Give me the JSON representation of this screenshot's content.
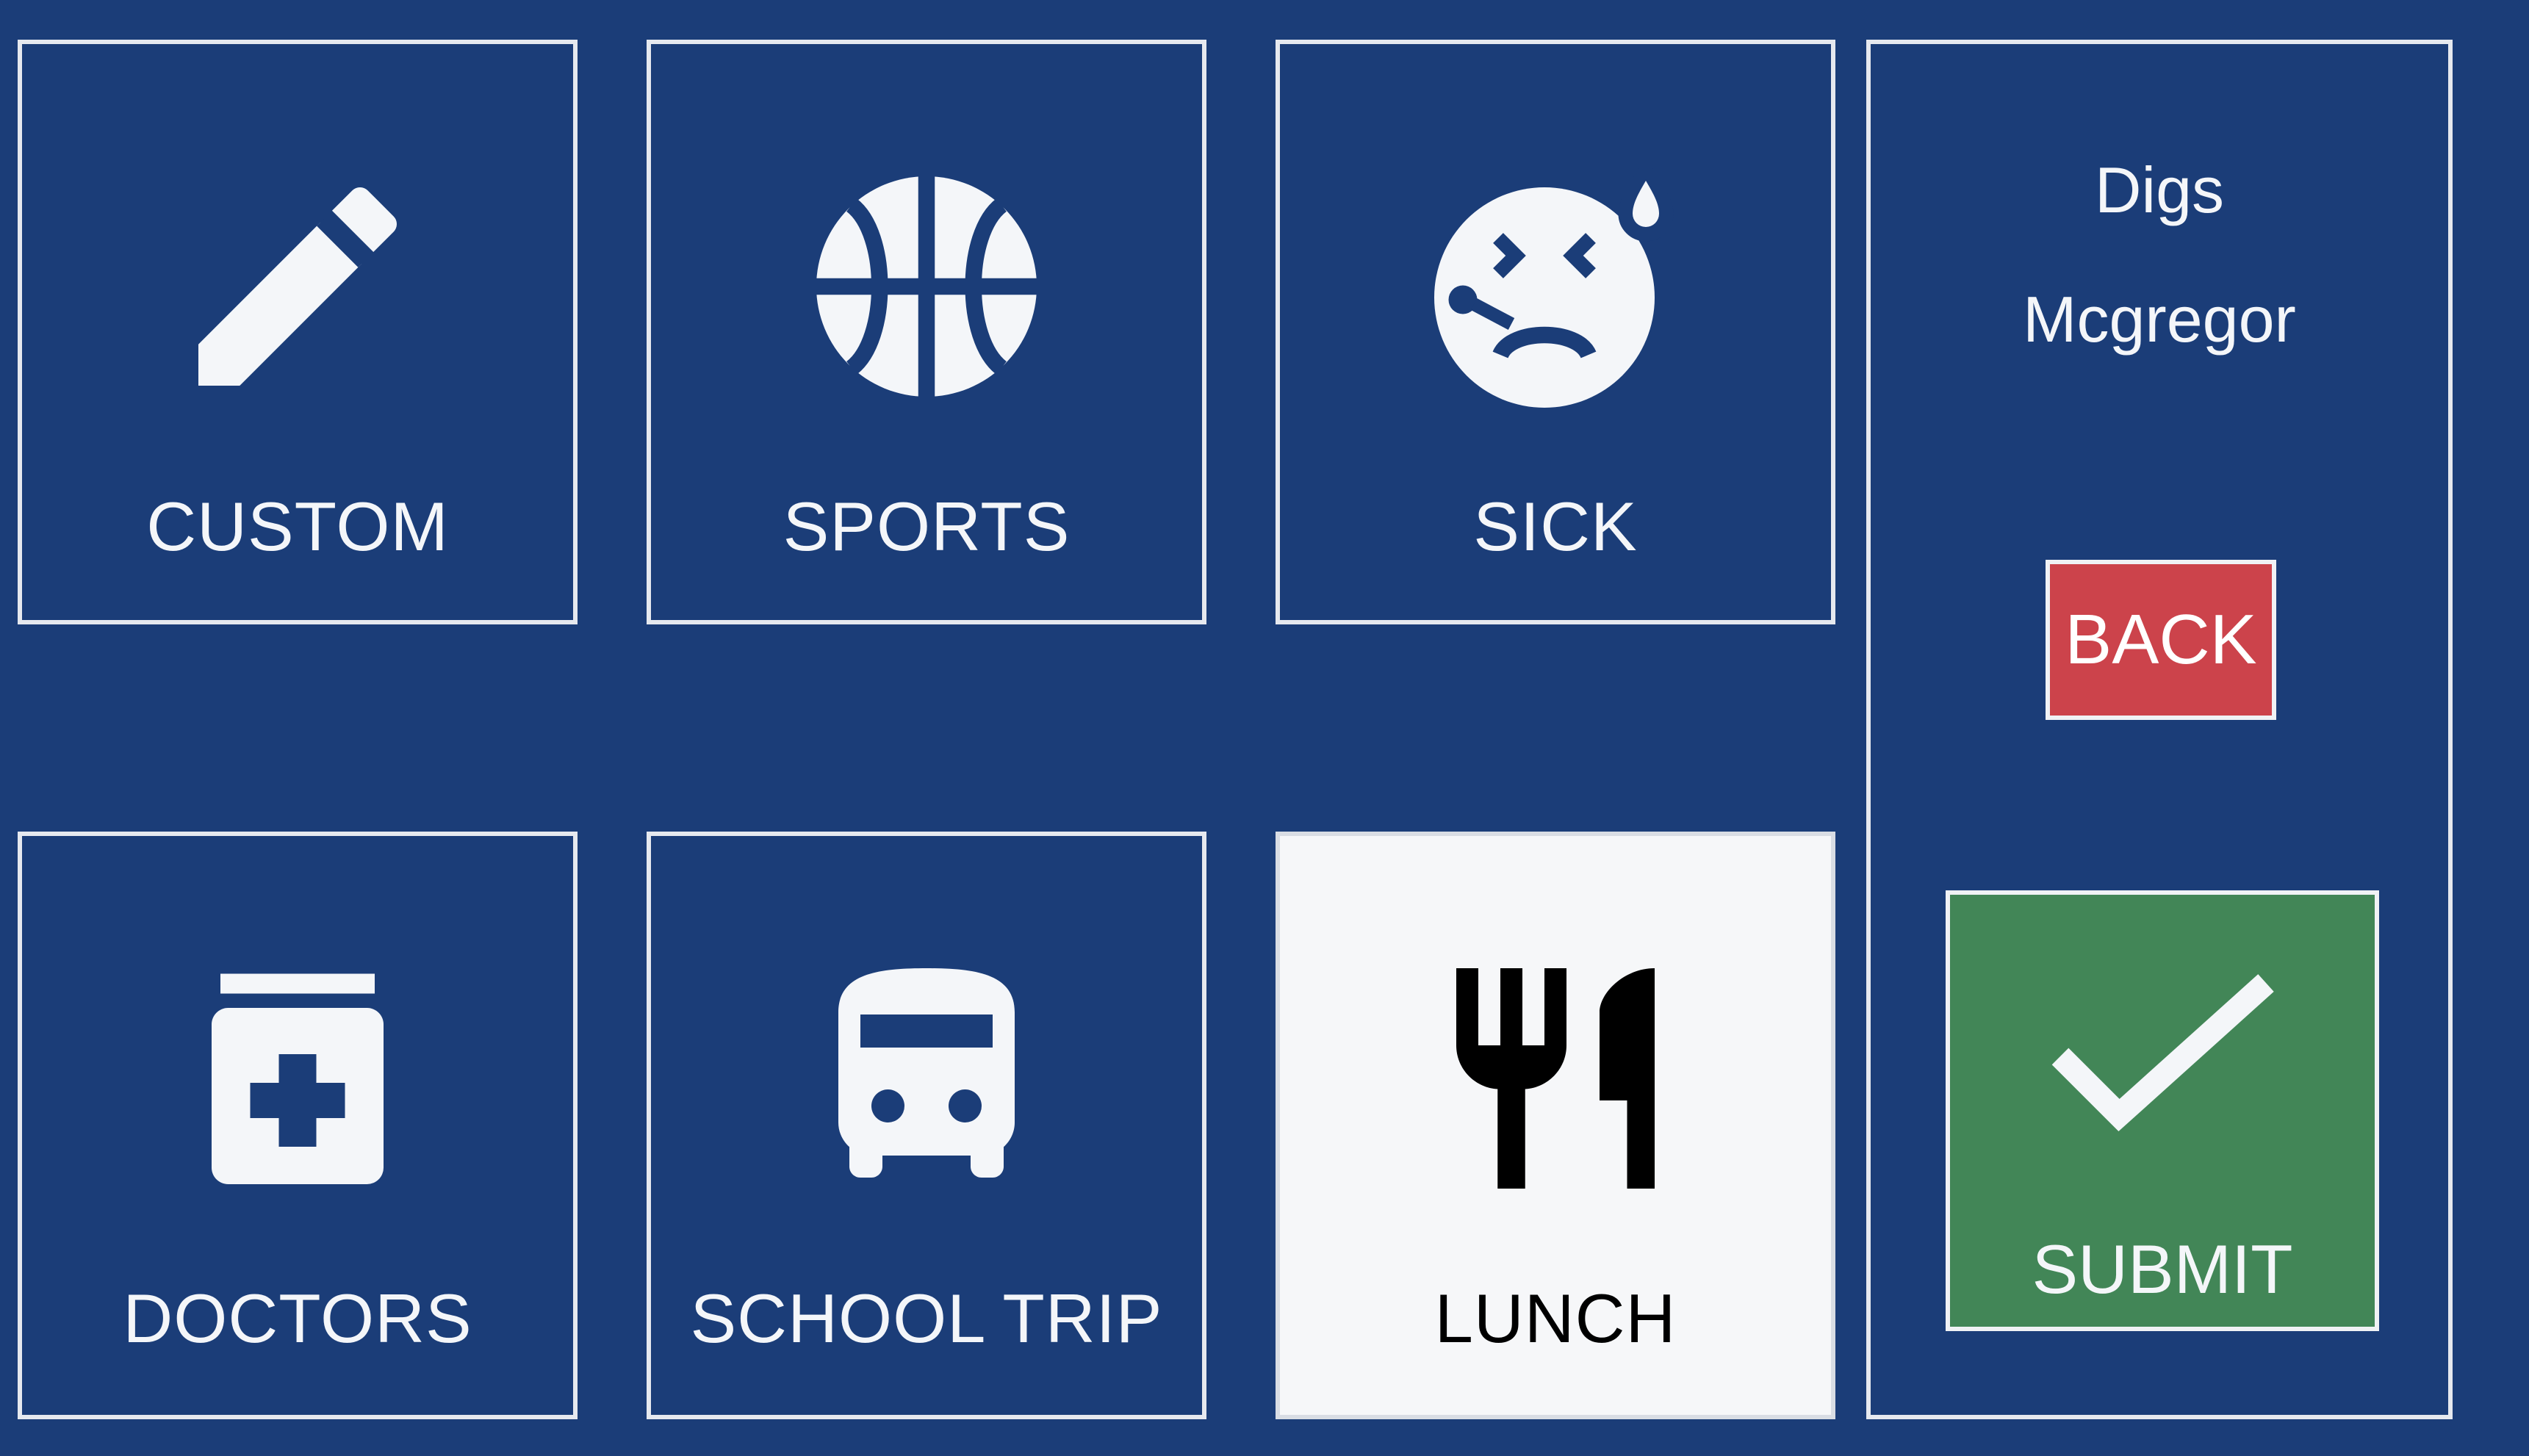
{
  "reasons": {
    "custom": "CUSTOM",
    "sports": "SPORTS",
    "sick": "SICK",
    "doctors": "DOCTORS",
    "school_trip": "SCHOOL TRIP",
    "lunch": "LUNCH"
  },
  "selected_reason": "LUNCH",
  "student": {
    "first_name": "Digs",
    "last_name": "Mcgregor"
  },
  "actions": {
    "back": "BACK",
    "submit": "SUBMIT"
  },
  "icons": {
    "custom": "pencil-icon",
    "sports": "basketball-icon",
    "sick": "sick-face-icon",
    "doctors": "medicine-jar-icon",
    "school_trip": "bus-icon",
    "lunch": "fork-knife-icon",
    "submit": "checkmark-icon"
  },
  "colors": {
    "background": "#1b3d78",
    "tile_border": "#e6e9ef",
    "selected_tile": "#f6f7f9",
    "back_button": "#cc434b",
    "submit_button": "#428657"
  }
}
